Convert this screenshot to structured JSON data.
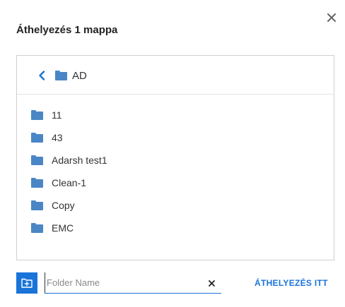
{
  "dialog": {
    "title": "Áthelyezés 1 mappa",
    "close_icon": "close-icon"
  },
  "browser": {
    "current_folder": "AD",
    "back_icon": "chevron-left-icon",
    "folder_icon": "folder-icon",
    "folders": [
      {
        "label": "11"
      },
      {
        "label": "43"
      },
      {
        "label": "Adarsh test1"
      },
      {
        "label": "Clean-1"
      },
      {
        "label": "Copy"
      },
      {
        "label": "EMC"
      }
    ]
  },
  "footer": {
    "new_folder_icon": "new-folder-icon",
    "folder_name_placeholder": "Folder Name",
    "folder_name_value": "",
    "clear_icon": "close-icon",
    "move_here_label": "ÁTHELYEZÉS ITT"
  },
  "colors": {
    "accent": "#1a73d9",
    "folder": "#4a86c5",
    "text": "#333333",
    "border": "#cfcfcf"
  }
}
